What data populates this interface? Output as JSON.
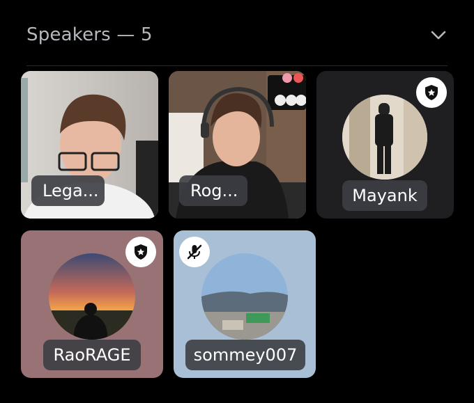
{
  "header": {
    "title": "Speakers — 5"
  },
  "speakers": [
    {
      "name": "Lega...",
      "type": "video"
    },
    {
      "name": "Rog...",
      "type": "video"
    },
    {
      "name": "Mayank",
      "type": "avatar",
      "badge": "moderator-shield-icon",
      "tile_color": "#1f1f22"
    },
    {
      "name": "RaoRAGE",
      "type": "avatar",
      "badge": "moderator-shield-icon",
      "tile_color": "#987275"
    },
    {
      "name": "sommey007",
      "type": "avatar",
      "badge": "muted-mic-icon",
      "tile_color": "#a9bfd6"
    }
  ]
}
